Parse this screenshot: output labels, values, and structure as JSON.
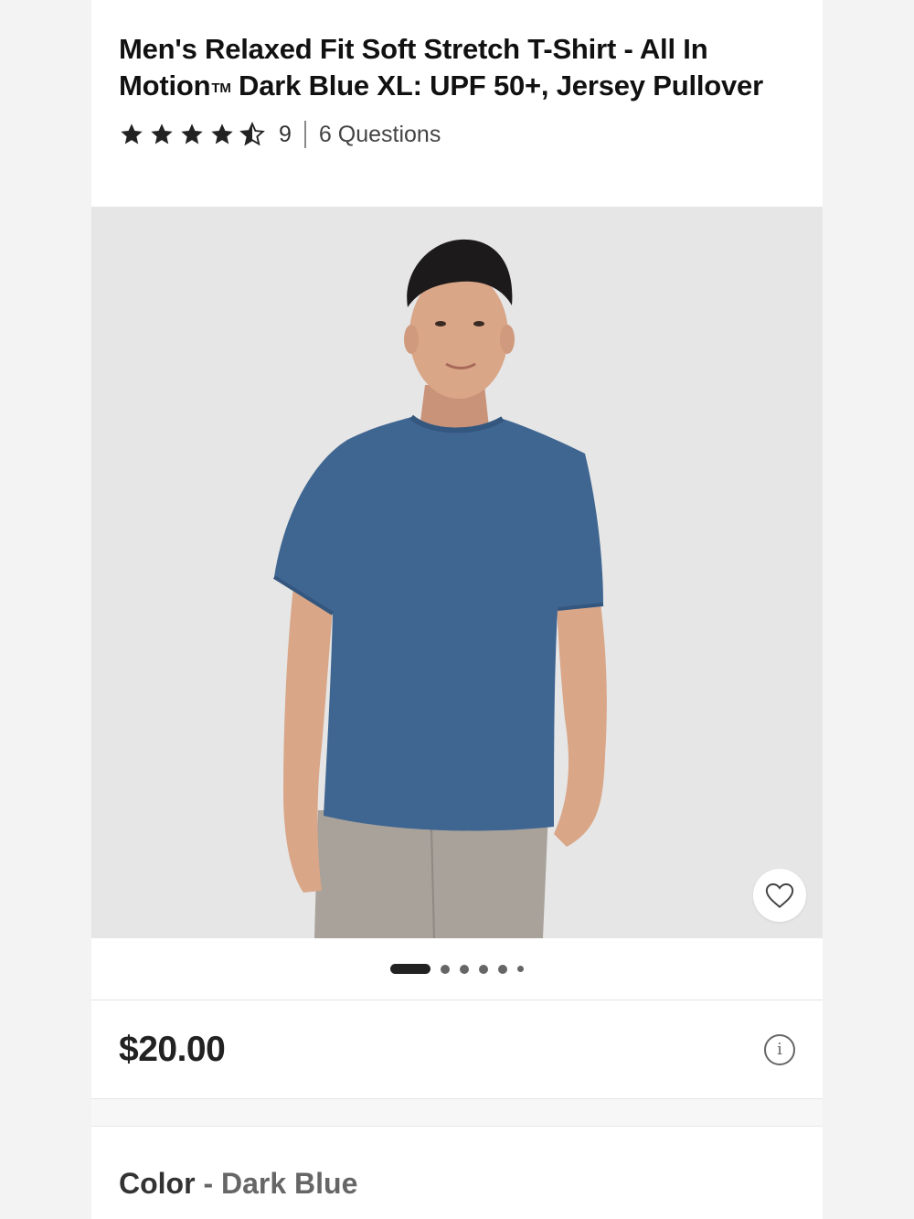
{
  "product": {
    "title_part1": "Men's Relaxed Fit Soft Stretch T-Shirt - All In Motion",
    "title_tm": "TM",
    "title_part2": " Dark Blue XL: UPF 50+, Jersey Pullover",
    "rating_value": 4.5,
    "rating_max": 5,
    "rating_count": "9",
    "questions": "6 Questions"
  },
  "gallery": {
    "image_alt": "Man wearing dark blue relaxed fit t-shirt and gray pants",
    "image_count": 6,
    "active_index": 0
  },
  "price": {
    "current": "$20.00",
    "info_icon": "i"
  },
  "color": {
    "label": "Color",
    "separator": " - ",
    "value": "Dark Blue"
  },
  "colors": {
    "shirt": "#3f6591",
    "pants": "#a8a29b",
    "background": "#e6e6e6",
    "skin": "#d9a688",
    "hair": "#1c1a1a"
  }
}
